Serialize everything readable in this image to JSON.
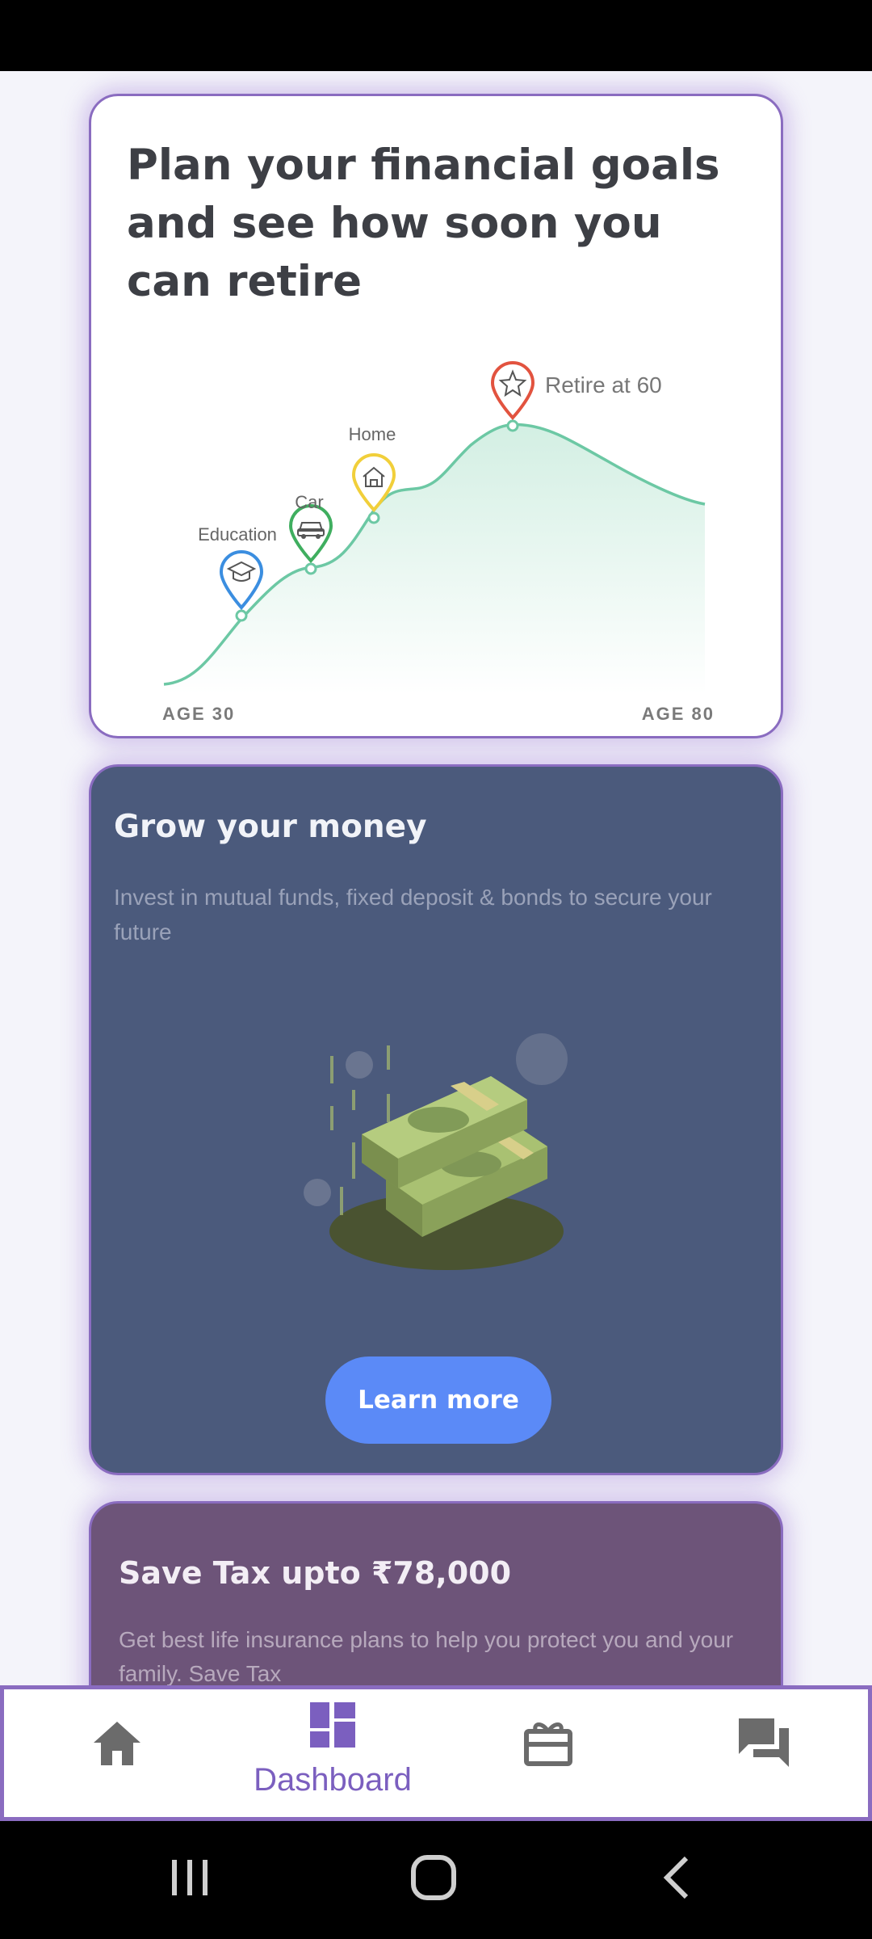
{
  "goals_card": {
    "title": "Plan your financial goals and see how soon you can retire",
    "milestones": [
      {
        "label": "Education",
        "icon": "graduation-cap-icon",
        "color": "#3b8ee0"
      },
      {
        "label": "Car",
        "icon": "car-icon",
        "color": "#3fae5f"
      },
      {
        "label": "Home",
        "icon": "home-icon",
        "color": "#f1cf3a"
      },
      {
        "label": "Retire at 60",
        "icon": "star-icon",
        "color": "#e2533f"
      }
    ],
    "start_label": "AGE 30",
    "end_label": "AGE 80",
    "curve_color": "#6cc8a4"
  },
  "grow_card": {
    "title": "Grow your money",
    "description": "Invest in mutual funds, fixed deposit & bonds to secure your future",
    "button_label": "Learn more",
    "illustration": "money-stack-icon",
    "accent": "#5b8af7"
  },
  "tax_card": {
    "title": "Save Tax upto ₹78,000",
    "description": "Get best life insurance plans to help you protect you and your family. Save Tax"
  },
  "bottom_nav": {
    "items": [
      {
        "icon": "home-icon",
        "label": "",
        "active": false
      },
      {
        "icon": "dashboard-icon",
        "label": "Dashboard",
        "active": true
      },
      {
        "icon": "gift-icon",
        "label": "",
        "active": false
      },
      {
        "icon": "chat-icon",
        "label": "",
        "active": false
      }
    ],
    "active_color": "#7b5fbf",
    "inactive_color": "#6b6b6b"
  },
  "system_nav": {
    "buttons": [
      "recent-apps-icon",
      "home-circle-icon",
      "back-icon"
    ]
  }
}
